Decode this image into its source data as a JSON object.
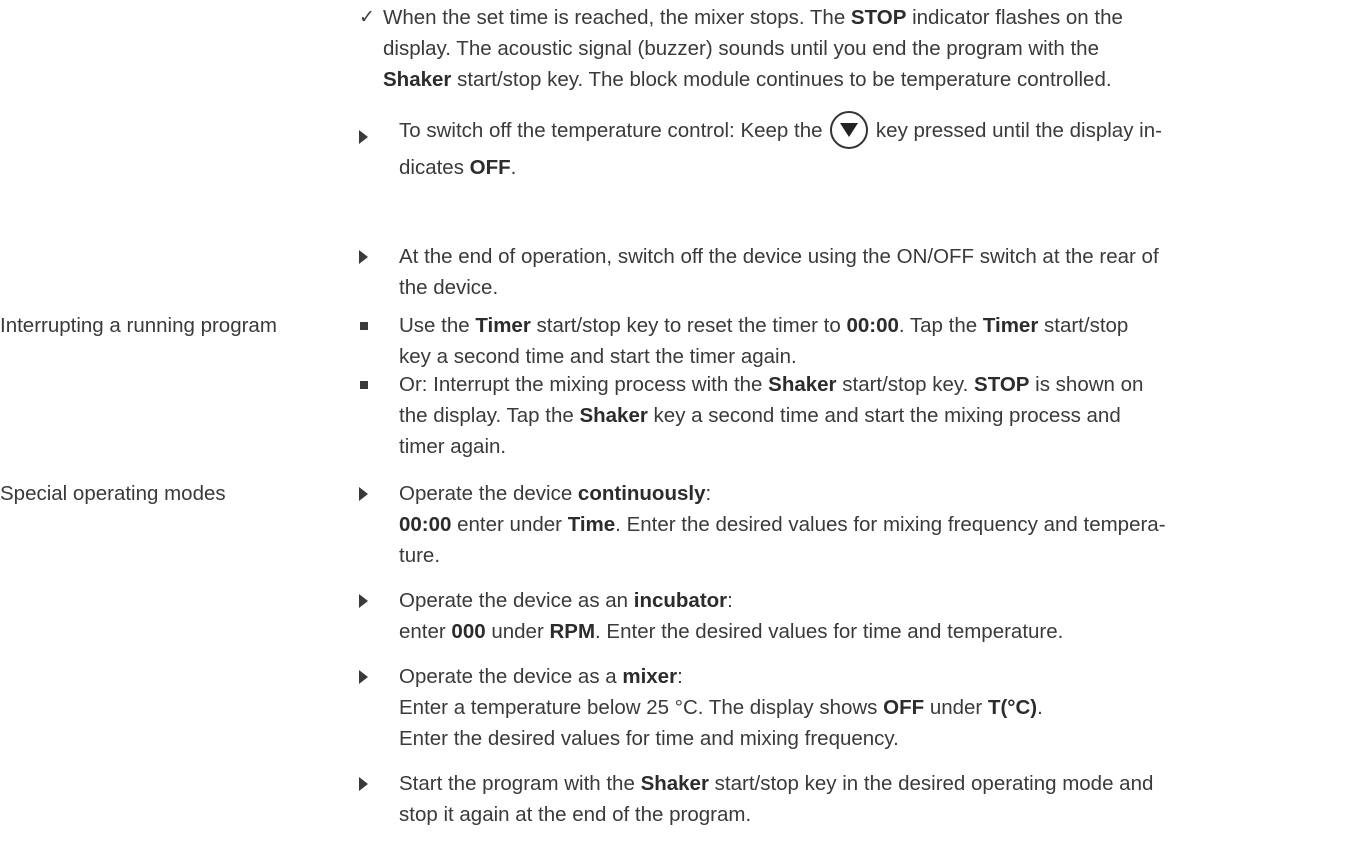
{
  "check_item": {
    "lines": [
      [
        "When the set time is reached, the mixer stops. The ",
        {
          "b": "STOP"
        },
        " indicator flashes on the"
      ],
      [
        "display. The acoustic signal (buzzer) sounds until you end the program with the"
      ],
      [
        {
          "b": "Shaker"
        },
        " start/stop key. The block module continues to be temperature controlled."
      ]
    ]
  },
  "step_temp_off": {
    "line1_pre": "To switch off the temperature control: Keep the ",
    "key_icon": "down-arrow-key-icon",
    "line1_post": " key pressed until the display in-",
    "line2_pre": "dicates ",
    "line2_bold": "OFF",
    "line2_post": "."
  },
  "step_switch_off": {
    "lines": [
      [
        "At the end of operation, switch off the device using the ON/OFF switch at the rear of"
      ],
      [
        "the device."
      ]
    ]
  },
  "interrupt": {
    "side_label": "Interrupting a running program",
    "items": [
      {
        "lines": [
          [
            "Use the ",
            {
              "b": "Timer"
            },
            " start/stop key to reset the timer to ",
            {
              "b": "00:00"
            },
            ". Tap the ",
            {
              "b": "Timer"
            },
            " start/stop"
          ],
          [
            "key a second time and start the timer again."
          ]
        ]
      },
      {
        "lines": [
          [
            "Or: Interrupt the mixing process with the ",
            {
              "b": "Shaker"
            },
            " start/stop key. ",
            {
              "b": "STOP"
            },
            " is shown on"
          ],
          [
            "the display. Tap the ",
            {
              "b": "Shaker"
            },
            " key a second time and start the mixing process and"
          ],
          [
            "timer again."
          ]
        ]
      }
    ]
  },
  "special": {
    "side_label": "Special operating modes",
    "items": [
      {
        "lines": [
          [
            "Operate the device ",
            {
              "b": "continuously"
            },
            ":"
          ],
          [
            {
              "b": "00:00"
            },
            " enter under ",
            {
              "b": "Time"
            },
            ". Enter the desired values for mixing frequency and tempera-"
          ],
          [
            "ture."
          ]
        ]
      },
      {
        "lines": [
          [
            "Operate the device as an ",
            {
              "b": "incubator"
            },
            ":"
          ],
          [
            "enter ",
            {
              "b": "000"
            },
            " under ",
            {
              "b": "RPM"
            },
            ". Enter the desired values for time and temperature."
          ]
        ]
      },
      {
        "lines": [
          [
            "Operate the device as a ",
            {
              "b": "mixer"
            },
            ":"
          ],
          [
            "Enter a temperature below 25 °C. The display shows ",
            {
              "b": "OFF"
            },
            " under ",
            {
              "b": "T(°C)"
            },
            "."
          ],
          [
            "Enter the desired values for time and mixing frequency."
          ]
        ]
      },
      {
        "lines": [
          [
            "Start the program with the ",
            {
              "b": "Shaker"
            },
            " start/stop key in the desired operating mode and"
          ],
          [
            "stop it again at the end of the program."
          ]
        ]
      }
    ]
  }
}
